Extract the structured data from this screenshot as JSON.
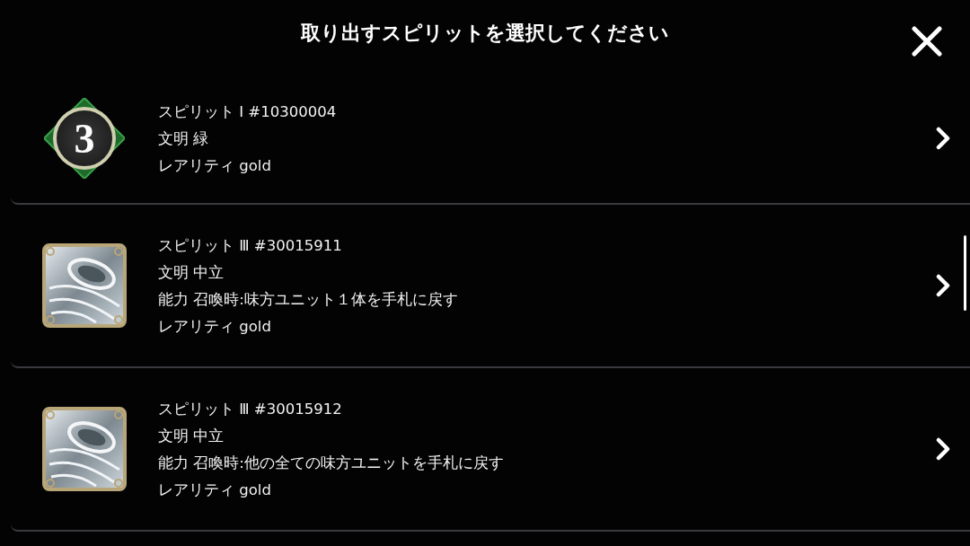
{
  "dialog": {
    "title": "取り出すスピリットを選択してください"
  },
  "spirits": [
    {
      "kind": "number",
      "badge": "3",
      "lines": [
        "スピリット I #10300004",
        "文明 緑",
        "レアリティ gold"
      ]
    },
    {
      "kind": "image",
      "lines": [
        "スピリット Ⅲ #30015911",
        "文明 中立",
        "能力 召喚時:味方ユニット１体を手札に戻す",
        "レアリティ gold"
      ]
    },
    {
      "kind": "image",
      "lines": [
        "スピリット Ⅲ #30015912",
        "文明 中立",
        "能力 召喚時:他の全ての味方ユニットを手札に戻す",
        "レアリティ gold"
      ]
    }
  ]
}
